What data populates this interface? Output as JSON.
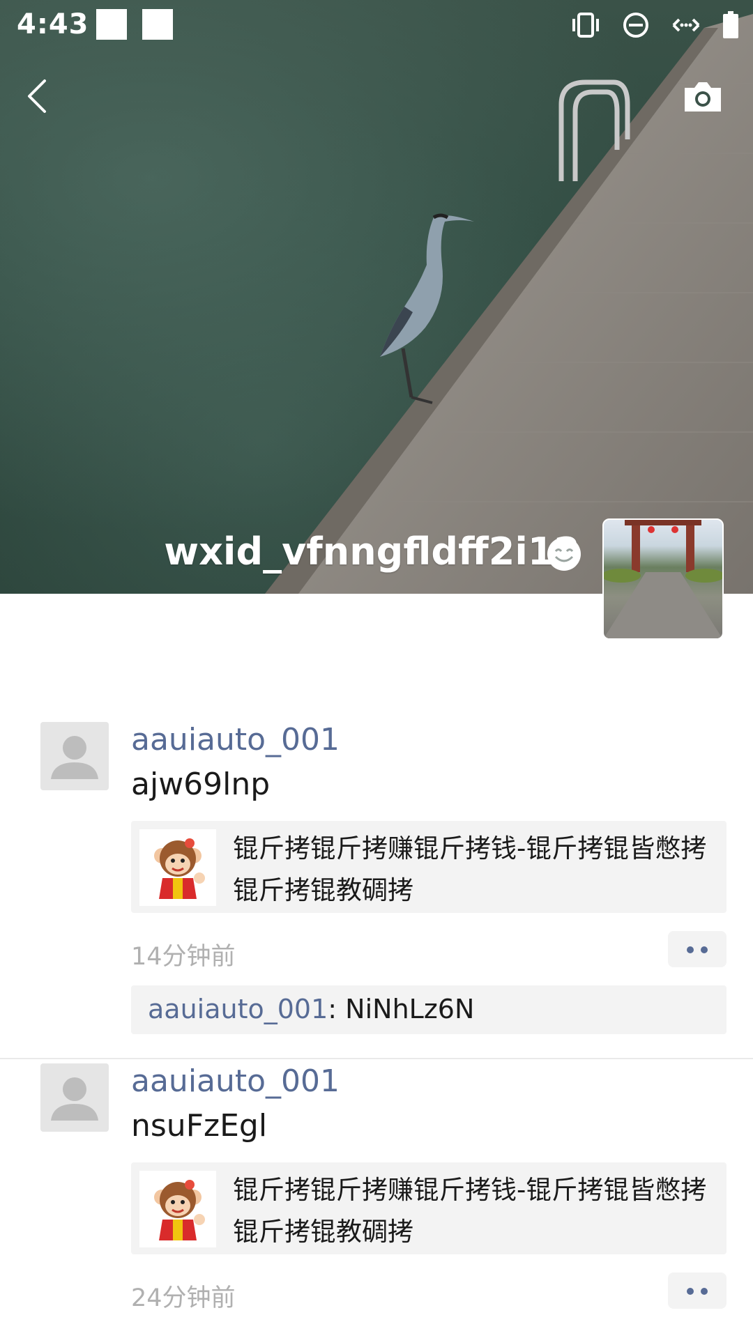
{
  "status_bar": {
    "time": "4:43",
    "icons": [
      "notification-square",
      "notification-square",
      "vibrate-icon",
      "do-not-disturb-icon",
      "data-sync-icon",
      "battery-icon"
    ]
  },
  "header": {
    "back_icon": "chevron-left-icon",
    "camera_icon": "camera-icon"
  },
  "profile": {
    "name": "wxid_vfnngfldff2i12",
    "emoji_icon": "smile-icon"
  },
  "posts": [
    {
      "author": "aauiauto_001",
      "text": "ajw69lnp",
      "link_title": "锟斤拷锟斤拷赚锟斤拷钱-锟斤拷锟皆憋拷锟斤拷锟教碉拷",
      "time": "14分钟前",
      "comment": {
        "author": "aauiauto_001",
        "separator": ": ",
        "text": "NiNhLz6N"
      }
    },
    {
      "author": "aauiauto_001",
      "text": "nsuFzEgl",
      "link_title": "锟斤拷锟斤拷赚锟斤拷钱-锟斤拷锟皆憋拷锟斤拷锟教碉拷",
      "time": "24分钟前"
    }
  ],
  "colors": {
    "link_blue": "#576b95",
    "card_bg": "#f3f3f3",
    "time_gray": "#b0b0b0"
  }
}
